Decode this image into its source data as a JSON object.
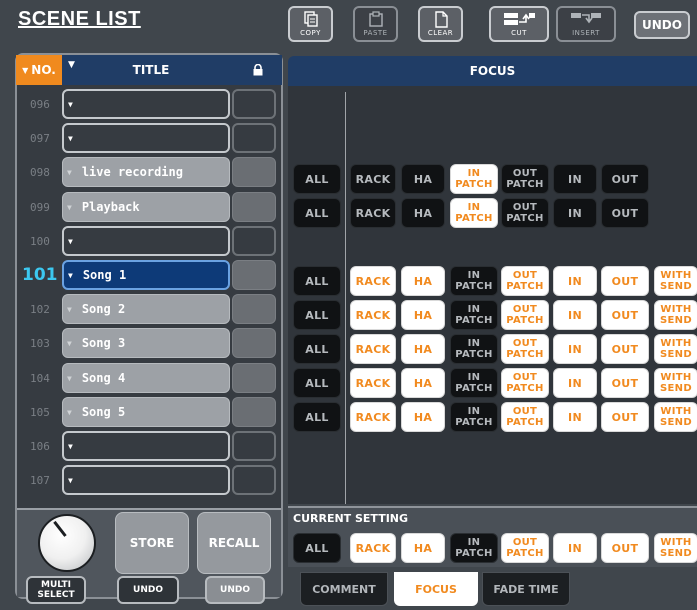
{
  "header": {
    "title": "SCENE LIST",
    "toolbar": {
      "copy": "COPY",
      "paste": "PASTE",
      "clear": "CLEAR",
      "cut": "CUT",
      "insert": "INSERT",
      "undo": "UNDO"
    }
  },
  "scene_list": {
    "columns": {
      "no": "NO.",
      "title": "TITLE"
    },
    "rows": [
      {
        "no": "096",
        "title": ""
      },
      {
        "no": "097",
        "title": ""
      },
      {
        "no": "098",
        "title": "live recording"
      },
      {
        "no": "099",
        "title": "Playback"
      },
      {
        "no": "100",
        "title": ""
      },
      {
        "no": "101",
        "title": "Song 1"
      },
      {
        "no": "102",
        "title": "Song 2"
      },
      {
        "no": "103",
        "title": "Song 3"
      },
      {
        "no": "104",
        "title": "Song 4"
      },
      {
        "no": "105",
        "title": "Song 5"
      },
      {
        "no": "106",
        "title": ""
      },
      {
        "no": "107",
        "title": ""
      }
    ],
    "knob_value": "101",
    "store": "STORE",
    "recall": "RECALL",
    "multi_select": "MULTI SELECT",
    "undo_outline": "UNDO",
    "undo_solid": "UNDO"
  },
  "focus": {
    "title": "FOCUS",
    "chip_labels": {
      "all": "ALL",
      "rack": "RACK",
      "ha": "HA",
      "in_patch": "IN PATCH",
      "out_patch": "OUT PATCH",
      "in": "IN",
      "out": "OUT",
      "with_send": "WITH SEND"
    },
    "rows": [
      {
        "scene": "098",
        "on": [
          "in_patch"
        ]
      },
      {
        "scene": "099",
        "on": [
          "in_patch"
        ]
      },
      {
        "scene": "101",
        "on": [
          "rack",
          "ha",
          "out_patch",
          "in",
          "out",
          "with_send"
        ]
      },
      {
        "scene": "102",
        "on": [
          "rack",
          "ha",
          "out_patch",
          "in",
          "out",
          "with_send"
        ]
      },
      {
        "scene": "103",
        "on": [
          "rack",
          "ha",
          "out_patch",
          "in",
          "out",
          "with_send"
        ]
      },
      {
        "scene": "104",
        "on": [
          "rack",
          "ha",
          "out_patch",
          "in",
          "out",
          "with_send"
        ]
      },
      {
        "scene": "105",
        "on": [
          "rack",
          "ha",
          "out_patch",
          "in",
          "out",
          "with_send"
        ]
      }
    ],
    "current_setting_label": "CURRENT SETTING",
    "current_setting_on": [
      "rack",
      "ha",
      "out_patch",
      "in",
      "out",
      "with_send"
    ]
  },
  "tabs": {
    "comment": "COMMENT",
    "focus": "FOCUS",
    "fade_time": "FADE TIME"
  },
  "colors": {
    "accent_orange": "#f18a1f",
    "header_blue": "#203d66",
    "current_cyan": "#3cc8f0"
  }
}
